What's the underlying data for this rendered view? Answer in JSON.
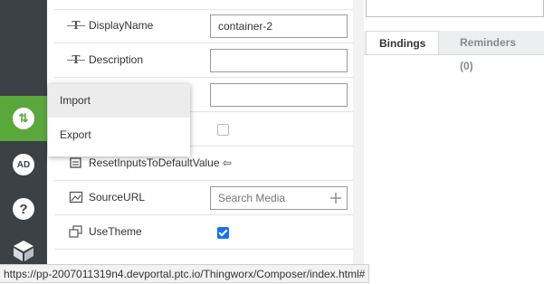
{
  "properties": [
    {
      "label": "DisplayName",
      "icon": "text-type-icon",
      "kind": "text",
      "value": "container-2"
    },
    {
      "label": "Description",
      "icon": "text-type-icon",
      "kind": "text",
      "value": ""
    },
    {
      "label": "",
      "icon": "text-type-icon",
      "kind": "text",
      "value": ""
    },
    {
      "label": "",
      "icon": "",
      "kind": "checkbox",
      "checked": false
    },
    {
      "label": "ResetInputsToDefaultValue",
      "icon": "service-icon",
      "kind": "binding",
      "suffix": "⇦"
    },
    {
      "label": "SourceURL",
      "icon": "image-icon",
      "kind": "search",
      "placeholder": "Search Media"
    },
    {
      "label": "UseTheme",
      "icon": "theme-icon",
      "kind": "checkbox",
      "checked": true
    }
  ],
  "tabs": {
    "bindings": "Bindings",
    "reminders": "Reminders (0)"
  },
  "menu": {
    "import": "Import",
    "export": "Export"
  },
  "rail": {
    "import_export_glyph": "⇅",
    "ad_glyph": "AD",
    "help_glyph": "?"
  },
  "status_url": "https://pp-2007011319n4.devportal.ptc.io/Thingworx/Composer/index.html#",
  "colors": {
    "rail": "#3c4146",
    "accent": "#5aa83c",
    "checkbox": "#1a73e8"
  }
}
